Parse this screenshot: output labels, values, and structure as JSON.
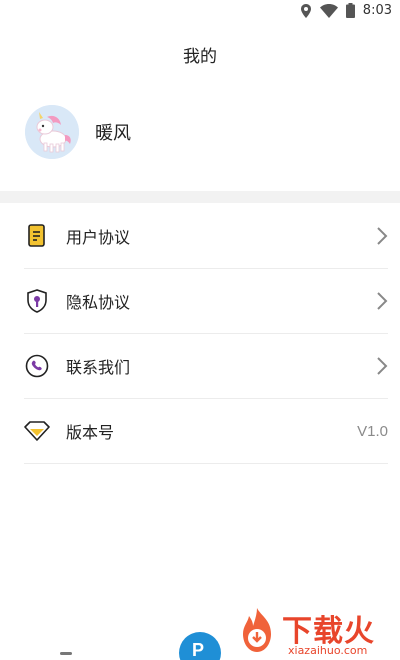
{
  "status_bar": {
    "time": "8:03",
    "icons": [
      "location-icon",
      "wifi-icon",
      "battery-icon"
    ]
  },
  "header": {
    "title": "我的"
  },
  "profile": {
    "name": "暖风",
    "avatar": "unicorn-avatar"
  },
  "menu": {
    "items": [
      {
        "label": "用户协议",
        "icon": "document-icon",
        "chevron": true
      },
      {
        "label": "隐私协议",
        "icon": "shield-lock-icon",
        "chevron": true
      },
      {
        "label": "联系我们",
        "icon": "phone-icon",
        "chevron": true
      },
      {
        "label": "版本号",
        "icon": "diamond-icon",
        "value": "V1.0"
      }
    ]
  },
  "tabbar": {
    "center_button_glyph": "P"
  },
  "watermark": {
    "text": "下载火",
    "sub": "xiazaihuo.com"
  },
  "colors": {
    "accent_yellow": "#f2c230",
    "accent_purple": "#7b3aa5",
    "fab_blue": "#1f8fd6",
    "watermark_red": "#e8452b",
    "band_gray": "#f2f2f2"
  }
}
